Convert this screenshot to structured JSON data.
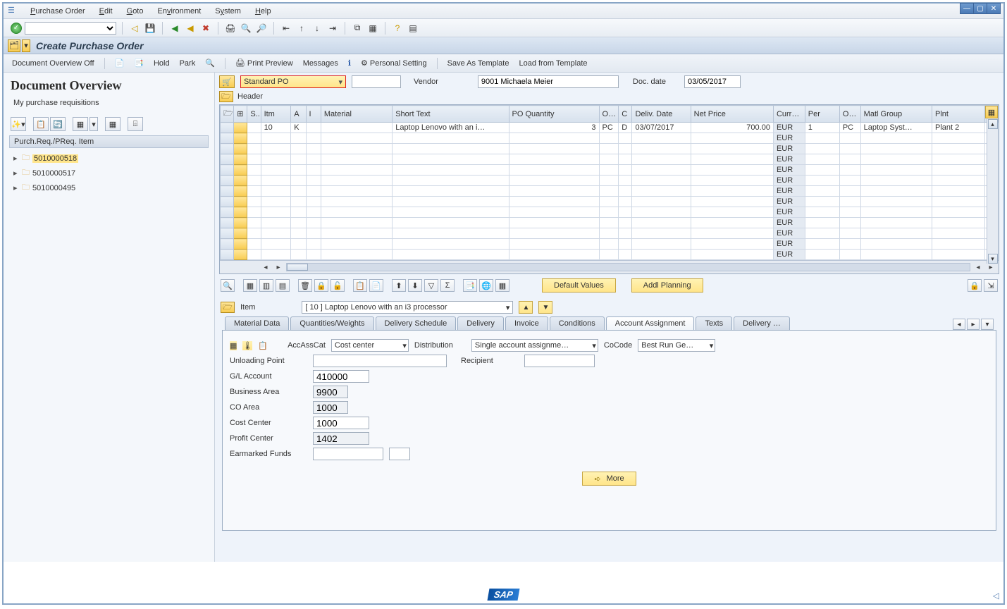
{
  "menubar": {
    "items": [
      {
        "label": "Purchase Order",
        "underline": "P"
      },
      {
        "label": "Edit",
        "underline": "E"
      },
      {
        "label": "Goto",
        "underline": "G"
      },
      {
        "label": "Environment",
        "underline": ""
      },
      {
        "label": "System",
        "underline": ""
      },
      {
        "label": "Help",
        "underline": "H"
      }
    ]
  },
  "titlebar": {
    "title": "Create Purchase Order"
  },
  "actionbar": {
    "doc_overview": "Document Overview Off",
    "hold": "Hold",
    "park": "Park",
    "print_preview": "Print Preview",
    "messages": "Messages",
    "personal_setting": "Personal Setting",
    "save_template": "Save As Template",
    "load_template": "Load from Template"
  },
  "sidebar": {
    "title": "Document Overview",
    "subtitle": "My purchase requisitions",
    "section": "Purch.Req./PReq. Item",
    "items": [
      "5010000518",
      "5010000517",
      "5010000495"
    ]
  },
  "po_header": {
    "type": "Standard PO",
    "vendor_label": "Vendor",
    "vendor_value": "9001 Michaela Meier",
    "docdate_label": "Doc. date",
    "docdate_value": "03/05/2017",
    "header_label": "Header"
  },
  "grid": {
    "columns": [
      "S..",
      "Itm",
      "A",
      "I",
      "Material",
      "Short Text",
      "PO Quantity",
      "O…",
      "C",
      "Deliv. Date",
      "Net Price",
      "Curr…",
      "Per",
      "O…",
      "Matl Group",
      "Plnt"
    ],
    "row": {
      "itm": "10",
      "a": "K",
      "short_text": "Laptop Lenovo with an i…",
      "qty": "3",
      "ou": "PC",
      "c": "D",
      "deliv": "03/07/2017",
      "price": "700.00",
      "curr": "EUR",
      "per": "1",
      "ou2": "PC",
      "matl": "Laptop Syst…",
      "plnt": "Plant 2"
    },
    "empty_curr": "EUR",
    "default_values": "Default Values",
    "addl_planning": "Addl Planning"
  },
  "item": {
    "label": "Item",
    "select": "[ 10 ] Laptop Lenovo with an i3 processor"
  },
  "tabs": [
    "Material Data",
    "Quantities/Weights",
    "Delivery Schedule",
    "Delivery",
    "Invoice",
    "Conditions",
    "Account Assignment",
    "Texts",
    "Delivery …"
  ],
  "active_tab": "Account Assignment",
  "account_assignment": {
    "accasscat_label": "AccAssCat",
    "accasscat_value": "Cost center",
    "distribution_label": "Distribution",
    "distribution_value": "Single account assignme…",
    "cocode_label": "CoCode",
    "cocode_value": "Best Run Ge…",
    "unloading_label": "Unloading Point",
    "recipient_label": "Recipient",
    "gl_label": "G/L Account",
    "gl_value": "410000",
    "ba_label": "Business Area",
    "ba_value": "9900",
    "co_label": "CO Area",
    "co_value": "1000",
    "cc_label": "Cost Center",
    "cc_value": "1000",
    "pc_label": "Profit Center",
    "pc_value": "1402",
    "ef_label": "Earmarked Funds",
    "more": "More"
  },
  "footer_logo": "SAP"
}
